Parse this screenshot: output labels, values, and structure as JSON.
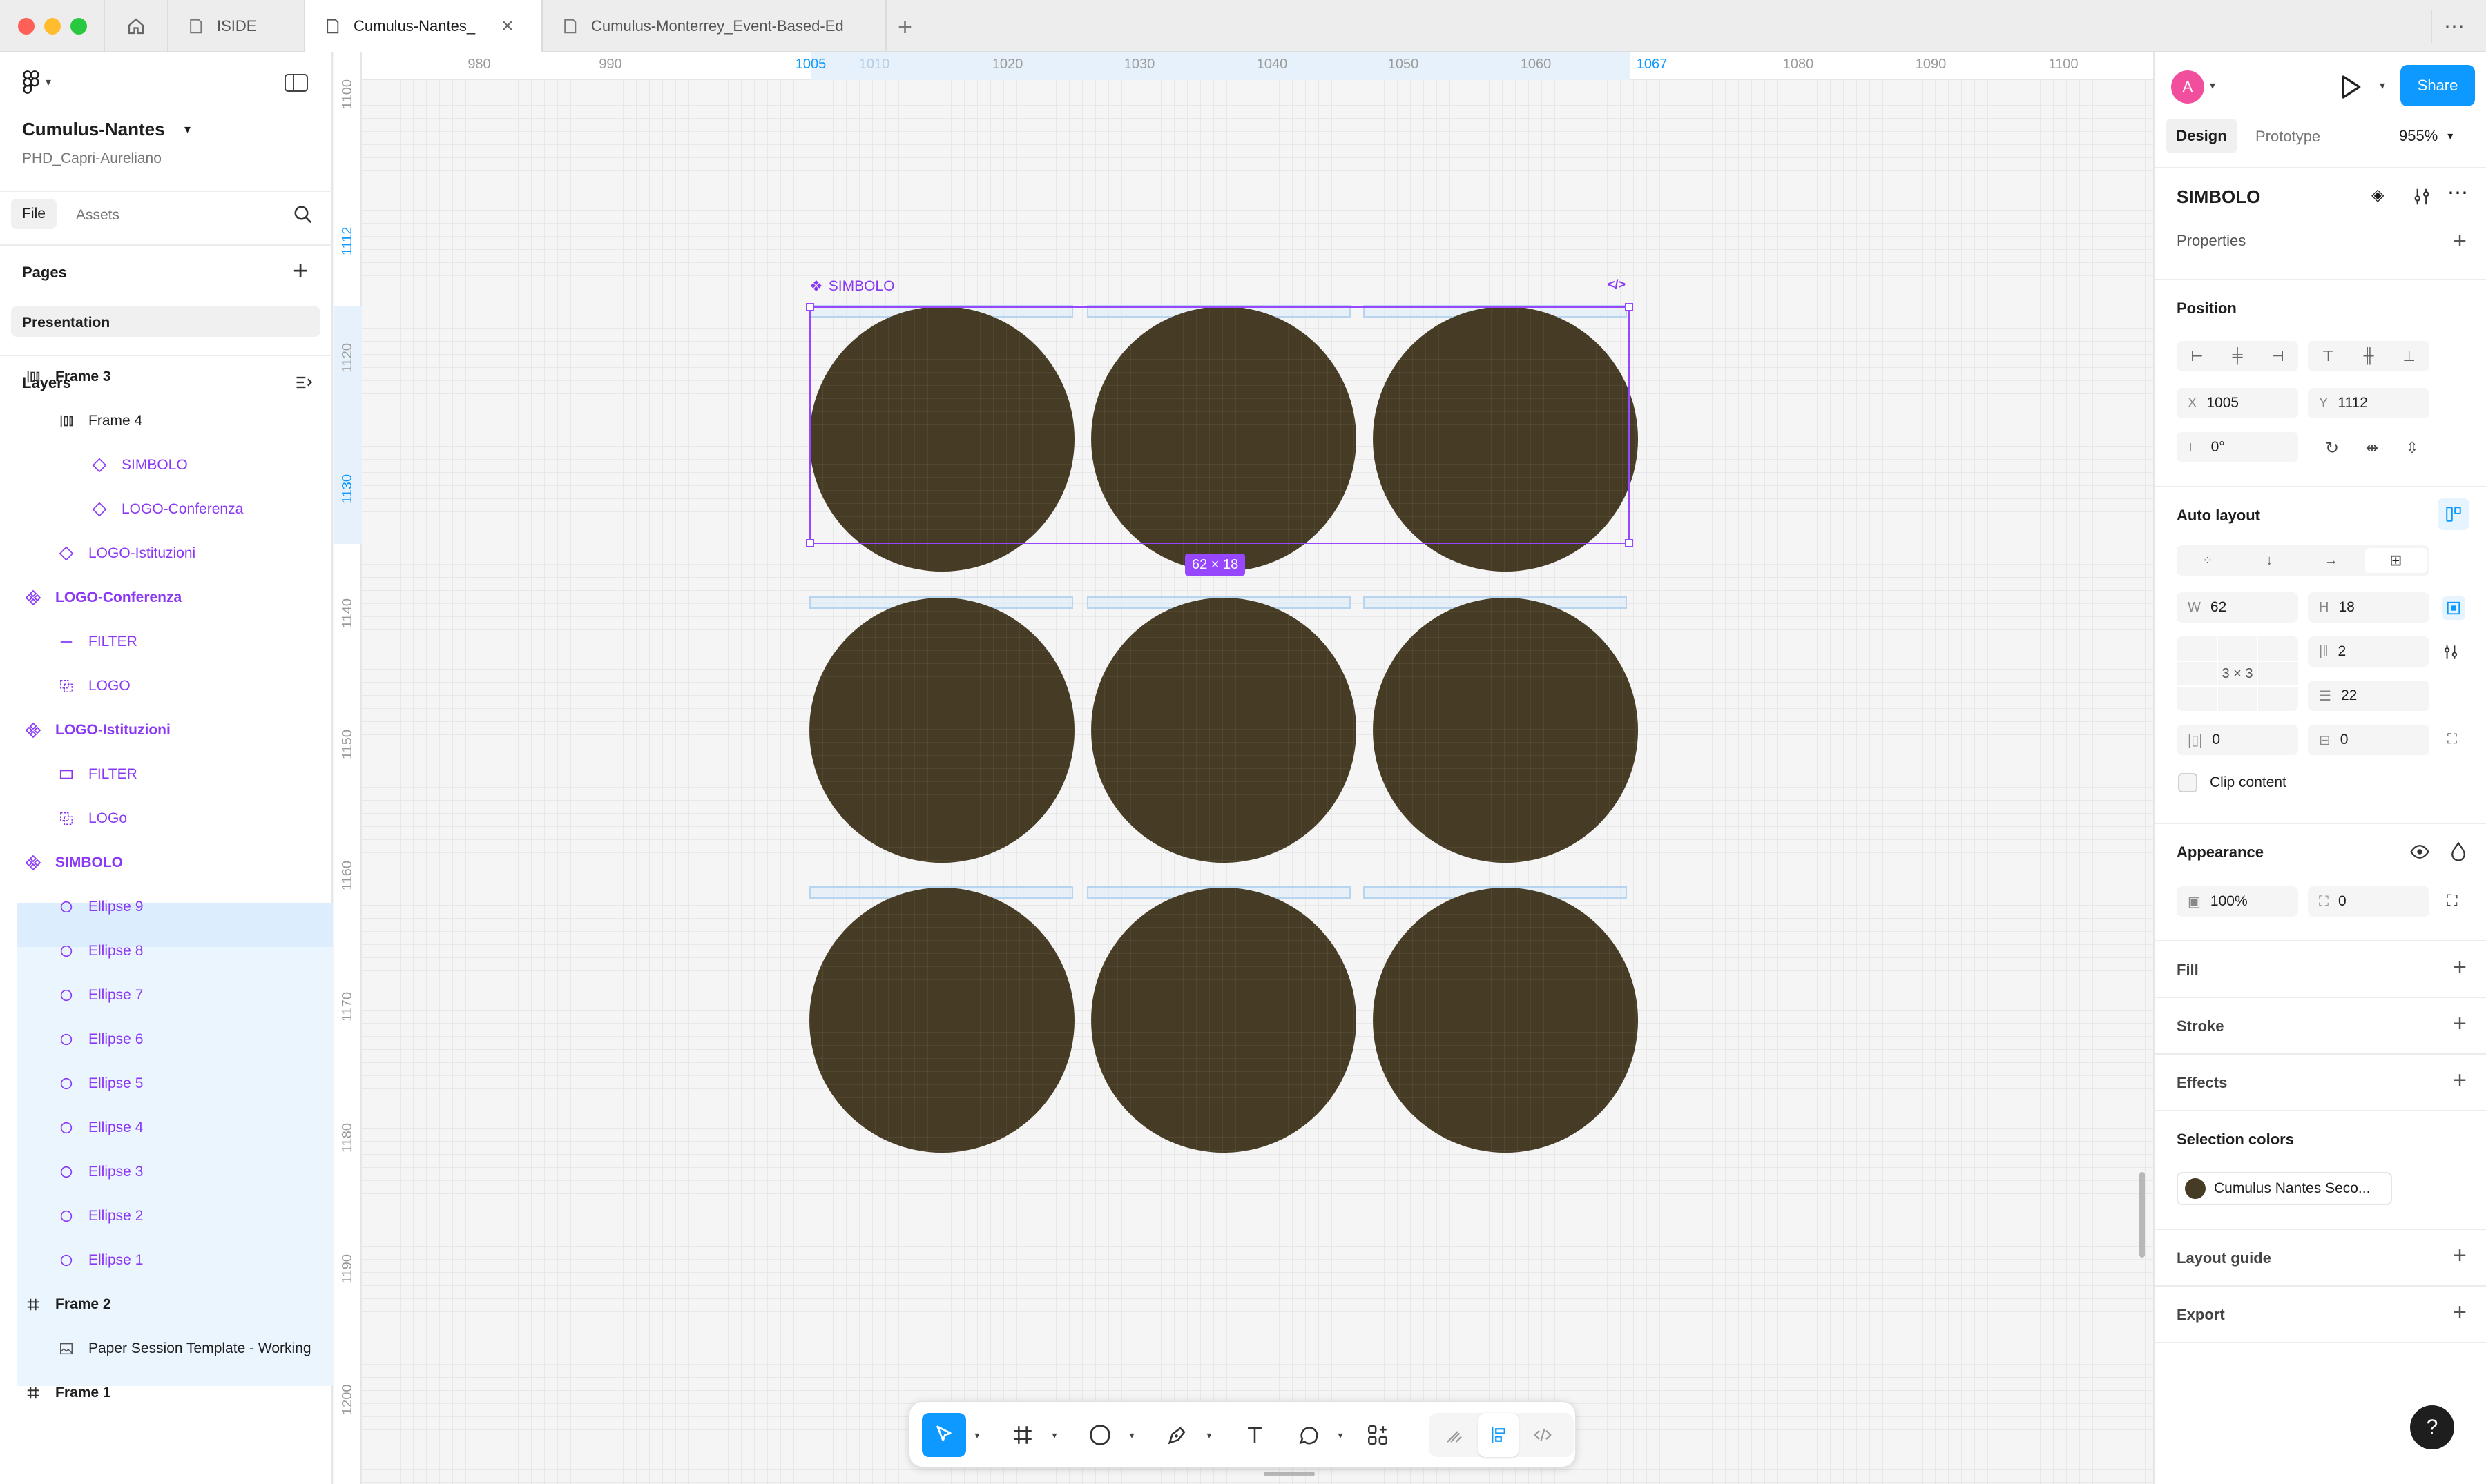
{
  "tabs": [
    {
      "label": "ISIDE"
    },
    {
      "label": "Cumulus-Nantes_"
    },
    {
      "label": "Cumulus-Monterrey_Event-Based-Ed"
    }
  ],
  "file": {
    "name": "Cumulus-Nantes_",
    "team": "PHD_Capri-Aureliano"
  },
  "left_tabs": {
    "file": "File",
    "assets": "Assets"
  },
  "pages": {
    "title": "Pages",
    "items": [
      "Presentation"
    ]
  },
  "layers": {
    "title": "Layers",
    "items": [
      {
        "label": "Frame 3",
        "icon": "frame-horizontal-icon"
      },
      {
        "label": "Frame 4",
        "icon": "frame-horizontal-icon"
      },
      {
        "label": "SIMBOLO",
        "icon": "instance-icon"
      },
      {
        "label": "LOGO-Conferenza",
        "icon": "instance-icon"
      },
      {
        "label": "LOGO-Istituzioni",
        "icon": "instance-icon"
      },
      {
        "label": "LOGO-Conferenza",
        "icon": "component-icon"
      },
      {
        "label": "FILTER",
        "icon": "line-icon"
      },
      {
        "label": "LOGO",
        "icon": "group-icon"
      },
      {
        "label": "LOGO-Istituzioni",
        "icon": "component-icon"
      },
      {
        "label": "FILTER",
        "icon": "rectangle-icon"
      },
      {
        "label": "LOGo",
        "icon": "group-icon"
      },
      {
        "label": "SIMBOLO",
        "icon": "component-icon"
      },
      {
        "label": "Ellipse 9",
        "icon": "ellipse-icon"
      },
      {
        "label": "Ellipse 8",
        "icon": "ellipse-icon"
      },
      {
        "label": "Ellipse 7",
        "icon": "ellipse-icon"
      },
      {
        "label": "Ellipse 6",
        "icon": "ellipse-icon"
      },
      {
        "label": "Ellipse 5",
        "icon": "ellipse-icon"
      },
      {
        "label": "Ellipse 4",
        "icon": "ellipse-icon"
      },
      {
        "label": "Ellipse 3",
        "icon": "ellipse-icon"
      },
      {
        "label": "Ellipse 2",
        "icon": "ellipse-icon"
      },
      {
        "label": "Ellipse 1",
        "icon": "ellipse-icon"
      },
      {
        "label": "Frame 2",
        "icon": "frame-icon"
      },
      {
        "label": "Paper Session Template - Working",
        "icon": "image-icon"
      },
      {
        "label": "Frame 1",
        "icon": "frame-icon"
      }
    ]
  },
  "ruler": {
    "top": [
      "980",
      "990",
      "1005",
      "1010",
      "1020",
      "1030",
      "1040",
      "1050",
      "1060",
      "1067",
      "1080",
      "1090",
      "1100"
    ],
    "left": [
      "1100",
      "1112",
      "1120",
      "1130",
      "1140",
      "1150",
      "1160",
      "1170",
      "1180",
      "1190",
      "1200"
    ]
  },
  "canvas": {
    "selection_label": "SIMBOLO",
    "size_badge": "62 × 18"
  },
  "right": {
    "avatar": "A",
    "share": "Share",
    "design_tab": "Design",
    "prototype_tab": "Prototype",
    "zoom": "955%",
    "component_name": "SIMBOLO",
    "properties": "Properties",
    "position": "Position",
    "x_label": "X",
    "x_value": "1005",
    "y_label": "Y",
    "y_value": "1112",
    "rotation": "0°",
    "auto_layout": "Auto layout",
    "w_label": "W",
    "w_value": "62",
    "h_label": "H",
    "h_value": "18",
    "grid": "3 × 3",
    "gap_h": "2",
    "gap_v": "22",
    "pad_h": "0",
    "pad_v": "0",
    "clip_content": "Clip content",
    "appearance": "Appearance",
    "opacity": "100%",
    "corner_radius": "0",
    "fill": "Fill",
    "stroke": "Stroke",
    "effects": "Effects",
    "selection_colors": "Selection colors",
    "color_name": "Cumulus Nantes Seco...",
    "layout_guide": "Layout guide",
    "export": "Export"
  },
  "colors": {
    "accent": "#0d99ff",
    "component": "#8a38f5",
    "ellipse_fill": "#463b24"
  }
}
